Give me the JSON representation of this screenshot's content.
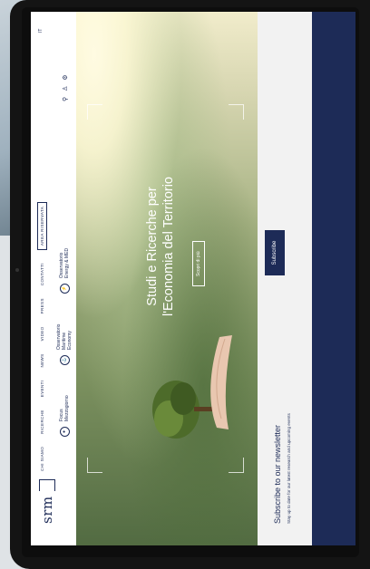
{
  "brand": {
    "logo": "srm"
  },
  "nav": {
    "items": [
      "chi siamo",
      "ricerche",
      "eventi",
      "news",
      "video",
      "press",
      "contatti"
    ],
    "cta": "area riservata"
  },
  "subnav": [
    {
      "label": "Focus Mezzogiorno",
      "icon": "focus-icon"
    },
    {
      "label": "Osservatorio Maritime Economy",
      "icon": "anchor-icon"
    },
    {
      "label": "Osservatorio Energy & MED",
      "icon": "energy-icon"
    }
  ],
  "tools": {
    "search": "⚲",
    "user": "♙",
    "settings": "⚙"
  },
  "lang": "IT",
  "hero": {
    "title_line1": "Studi e Ricerche per",
    "title_line2": "l'Economia del Territorio",
    "button": "Scopri di più"
  },
  "newsletter": {
    "title": "Subscribe to our newsletter",
    "subtitle": "Stay up to date for our latest research and upcoming events",
    "button": "Subscribe"
  },
  "colors": {
    "brand": "#1d2b57",
    "newsletter_bg": "#f2f2f2"
  }
}
